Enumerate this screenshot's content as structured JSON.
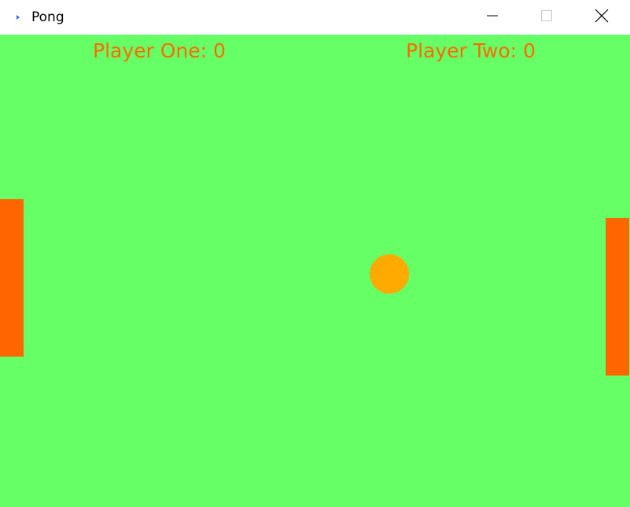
{
  "window": {
    "title": "Pong",
    "icon": "pong-app-icon"
  },
  "titlebar_buttons": {
    "minimize_icon": "minimize-icon",
    "maximize_icon": "maximize-icon",
    "close_icon": "close-icon"
  },
  "scoreboard": {
    "player_one_label": "Player One: 0",
    "player_two_label": "Player Two: 0",
    "player_one_score": 0,
    "player_two_score": 0
  },
  "colors": {
    "court": "#66ff66",
    "paddle": "#ff6600",
    "ball": "#ffaa00",
    "score_text": "#ff6a00"
  }
}
